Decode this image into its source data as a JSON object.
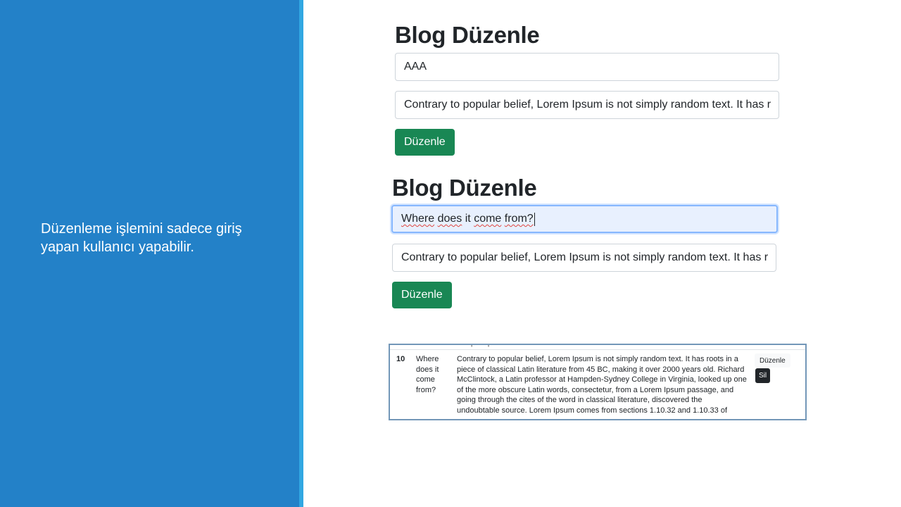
{
  "slide": {
    "text": "Düzenleme işlemini sadece giriş yapan kullanıcı yapabilir."
  },
  "form1": {
    "title": "Blog Düzenle",
    "title_input": "AAA",
    "content_input": "Contrary to popular belief, Lorem Ipsum is not simply random text. It has r",
    "button": "Düzenle"
  },
  "form2": {
    "title": "Blog Düzenle",
    "title_words": [
      "Where",
      "does",
      "it",
      "come",
      "from?"
    ],
    "content_input": "Contrary to popular belief, Lorem Ipsum is not simply random text. It has r",
    "button": "Düzenle"
  },
  "table": {
    "cut_text": "ursquseq",
    "row": {
      "id": "10",
      "title": "Where does it come from?",
      "content": "Contrary to popular belief, Lorem Ipsum is not simply random text. It has roots in a piece of classical Latin literature from 45 BC, making it over 2000 years old. Richard McClintock, a Latin professor at Hampden-Sydney College in Virginia, looked up one of the more obscure Latin words, consectetur, from a Lorem Ipsum passage, and going through the cites of the word in classical literature, discovered the undoubtable source. Lorem Ipsum comes from sections 1.10.32 and 1.10.33 of",
      "edit_button": "Düzenle",
      "delete_button": "Sil"
    }
  },
  "colors": {
    "slide_blue": "#2381c8",
    "accent_blue": "#31a7e2",
    "success_green": "#198754",
    "focus_bg": "#e8f0fe"
  }
}
